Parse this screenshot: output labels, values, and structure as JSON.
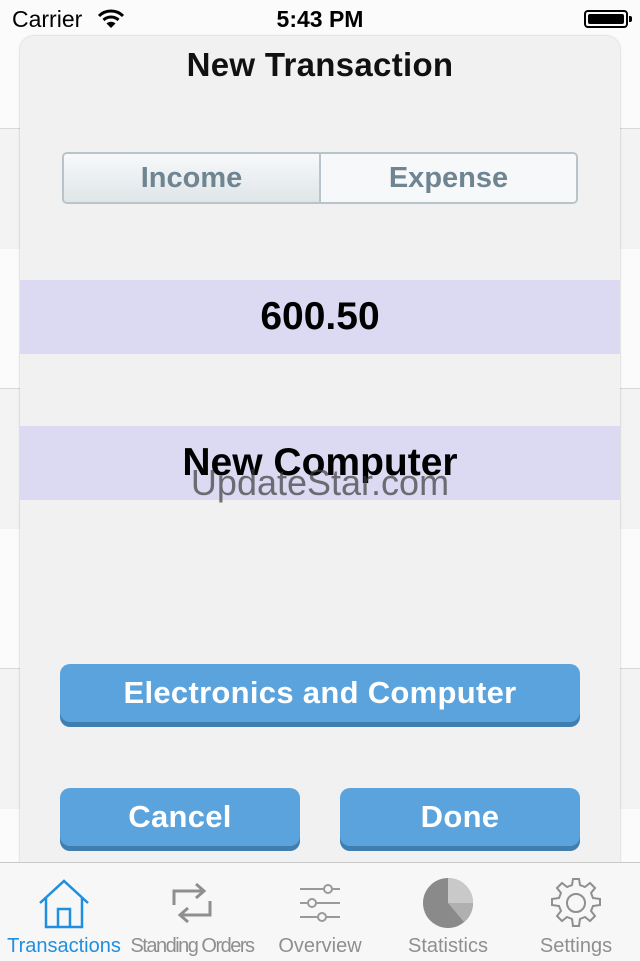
{
  "status_bar": {
    "carrier": "Carrier",
    "time": "5:43 PM"
  },
  "modal": {
    "title": "New Transaction",
    "segments": {
      "income": "Income",
      "expense": "Expense"
    },
    "amount": "600.50",
    "description": "New Computer",
    "category_button": "Electronics and Computer",
    "cancel_button": "Cancel",
    "done_button": "Done"
  },
  "watermark": "UpdateStar.com",
  "tab_bar": {
    "items": [
      {
        "label": "Transactions",
        "icon": "house-icon",
        "active": true
      },
      {
        "label": "Standing Orders",
        "icon": "repeat-icon"
      },
      {
        "label": "Overview",
        "icon": "sliders-icon"
      },
      {
        "label": "Statistics",
        "icon": "pie-chart-icon"
      },
      {
        "label": "Settings",
        "icon": "gear-icon"
      }
    ]
  },
  "colors": {
    "accent": "#1f8fe0",
    "button": "#5aa3dc",
    "band": "#dcdaf2",
    "segment_text": "#6f8592"
  }
}
